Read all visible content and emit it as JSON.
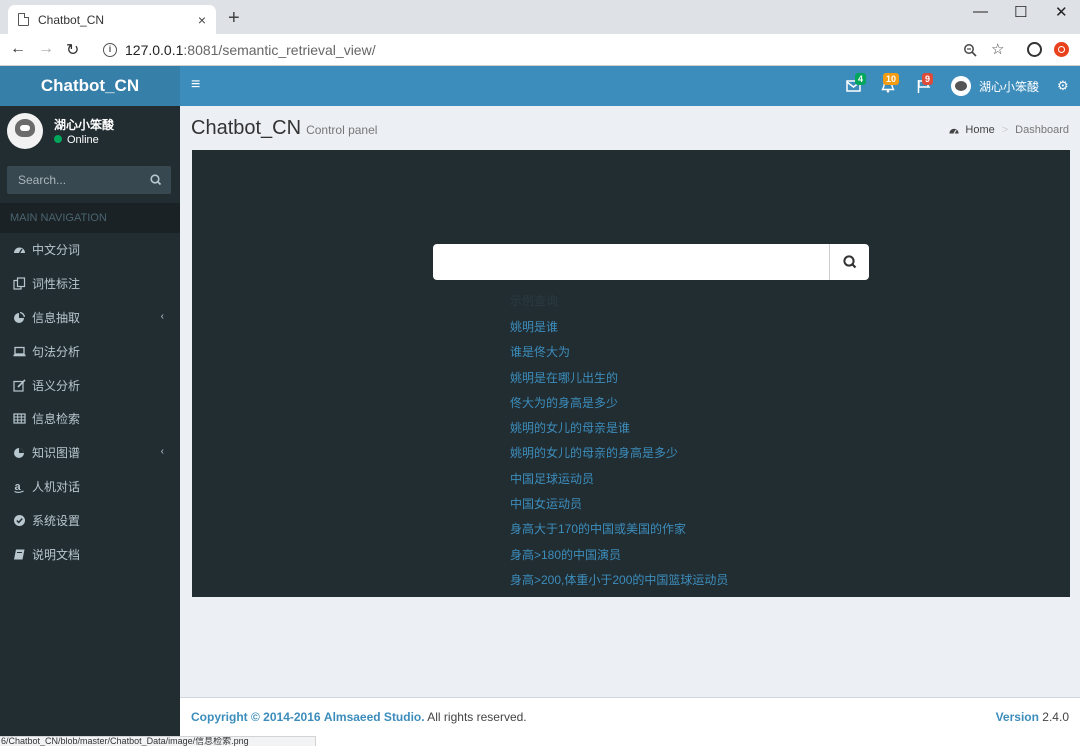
{
  "browser": {
    "tab_title": "Chatbot_CN",
    "tab_close": "×",
    "new_tab": "+",
    "minimize": "—",
    "maximize": "☐",
    "close": "✕",
    "url_host": "127.0.0.1",
    "url_path": ":8081/semantic_retrieval_view/",
    "status_url": "6/Chatbot_CN/blob/master/Chatbot_Data/image/信息检索.png"
  },
  "header": {
    "logo": "Chatbot_CN",
    "messages_count": "4",
    "notifications_count": "10",
    "tasks_count": "9",
    "user_name": "湖心小笨酸"
  },
  "sidebar": {
    "user_name": "湖心小笨酸",
    "status": "Online",
    "search_placeholder": "Search...",
    "nav_header": "MAIN NAVIGATION",
    "items": [
      {
        "label": "中文分词",
        "icon": "dashboard-icon"
      },
      {
        "label": "词性标注",
        "icon": "copy-icon"
      },
      {
        "label": "信息抽取",
        "icon": "pie-chart-icon",
        "caret": "‹"
      },
      {
        "label": "句法分析",
        "icon": "laptop-icon"
      },
      {
        "label": "语义分析",
        "icon": "edit-icon"
      },
      {
        "label": "信息检索",
        "icon": "table-icon"
      },
      {
        "label": "知识图谱",
        "icon": "pie-chart-icon",
        "caret": "‹"
      },
      {
        "label": "人机对话",
        "icon": "amazon-icon"
      },
      {
        "label": "系统设置",
        "icon": "check-circle-icon"
      },
      {
        "label": "说明文档",
        "icon": "book-icon"
      }
    ]
  },
  "content": {
    "title": "Chatbot_CN",
    "subtitle": "Control panel",
    "breadcrumb_home": "Home",
    "breadcrumb_sep": ">",
    "breadcrumb_current": "Dashboard",
    "search_value": "",
    "examples_header": "示例查询",
    "examples": [
      "姚明是谁",
      "谁是佟大为",
      "姚明是在哪儿出生的",
      "佟大为的身高是多少",
      "姚明的女儿的母亲是谁",
      "姚明的女儿的母亲的身高是多少",
      "中国足球运动员",
      "中国女运动员",
      "身高大于170的中国或美国的作家",
      "身高>180的中国演员",
      "身高>200,体重小于200的中国篮球运动员"
    ]
  },
  "footer": {
    "copyright_prefix": "Copyright © 2014-2016",
    "brand": "Almsaeed Studio.",
    "rights": "All rights reserved.",
    "version_label": "Version",
    "version": "2.4.0"
  },
  "colors": {
    "header_blue": "#3c8dbc",
    "logo_blue": "#367fa9",
    "sidebar_dark": "#222d32",
    "link_blue": "#3c8dbc"
  }
}
